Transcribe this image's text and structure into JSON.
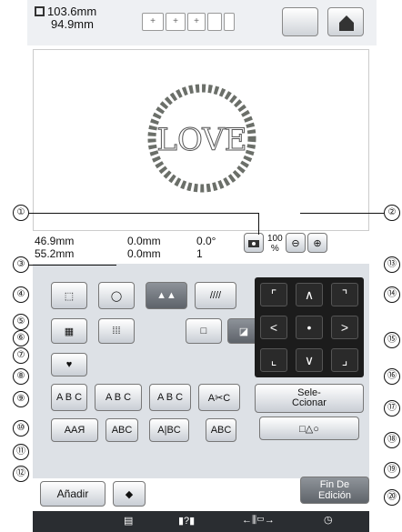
{
  "header": {
    "width_label": "103.6mm",
    "height_label": "94.9mm"
  },
  "canvas": {
    "design_text": "LOVE"
  },
  "info": {
    "w": "46.9mm",
    "h": "55.2mm",
    "dx": "0.0mm",
    "dy": "0.0mm",
    "angle": "0.0°",
    "count": "1",
    "zoom": "100",
    "zoom_unit": "%"
  },
  "buttons": {
    "abc1": "A B C",
    "abc2": "A B C",
    "abc3": "A B C",
    "ayc": "A✂C",
    "aa": "AAЯ",
    "abc_small": "ABC",
    "abc_mid": "A|BC",
    "abc_box": "ABC",
    "selec": "Sele-",
    "ccionar": "Ccionar",
    "shapes": "□△○",
    "add": "Añadir",
    "fin": "Fin De",
    "edicion": "Edición"
  },
  "callouts": [
    "①",
    "②",
    "③",
    "④",
    "⑤",
    "⑥",
    "⑦",
    "⑧",
    "⑨",
    "⑩",
    "⑪",
    "⑫",
    "⑬",
    "⑭",
    "⑮",
    "⑯",
    "⑰",
    "⑱",
    "⑲",
    "⑳"
  ]
}
